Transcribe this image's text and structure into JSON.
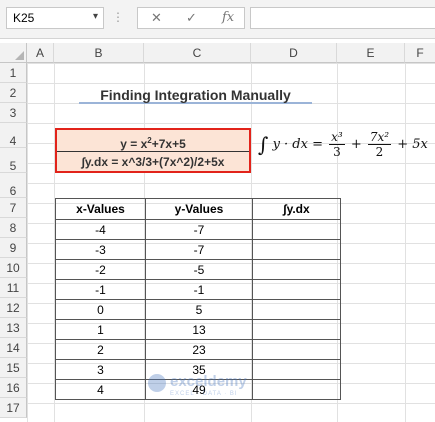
{
  "name_box": {
    "value": "K25"
  },
  "formula_bar": {
    "fx_label": "fx",
    "value": ""
  },
  "columns": [
    "A",
    "B",
    "C",
    "D",
    "E",
    "F"
  ],
  "rows": [
    "1",
    "2",
    "3",
    "4",
    "5",
    "6",
    "7",
    "8",
    "9",
    "10",
    "11",
    "12",
    "13",
    "14",
    "15",
    "16",
    "17"
  ],
  "title": "Finding Integration Manually",
  "equation_box": {
    "line1_main": "y = x",
    "line1_sup": "2",
    "line1_rest": "+7x+5",
    "line2": "∫y.dx = x^3/3+(7x^2)/2+5x"
  },
  "math_formula": {
    "integral": "∫",
    "integrand": "y · dx =",
    "frac1_num": "x³",
    "frac1_den": "3",
    "plus1": "+",
    "frac2_num": "7x²",
    "frac2_den": "2",
    "tail": "+ 5x"
  },
  "table": {
    "headers": [
      "x-Values",
      "y-Values",
      "∫y.dx"
    ],
    "rows": [
      [
        "-4",
        "-7",
        ""
      ],
      [
        "-3",
        "-7",
        ""
      ],
      [
        "-2",
        "-5",
        ""
      ],
      [
        "-1",
        "-1",
        ""
      ],
      [
        "0",
        "5",
        ""
      ],
      [
        "1",
        "13",
        ""
      ],
      [
        "2",
        "23",
        ""
      ],
      [
        "3",
        "35",
        ""
      ],
      [
        "4",
        "49",
        ""
      ]
    ]
  },
  "watermark": {
    "name": "exceldemy",
    "tagline": "EXCEL · DATA · BI"
  },
  "colors": {
    "highlight_fill": "#fce4d6",
    "highlight_border": "#e2231a",
    "title_underline": "#9bb4d8"
  }
}
